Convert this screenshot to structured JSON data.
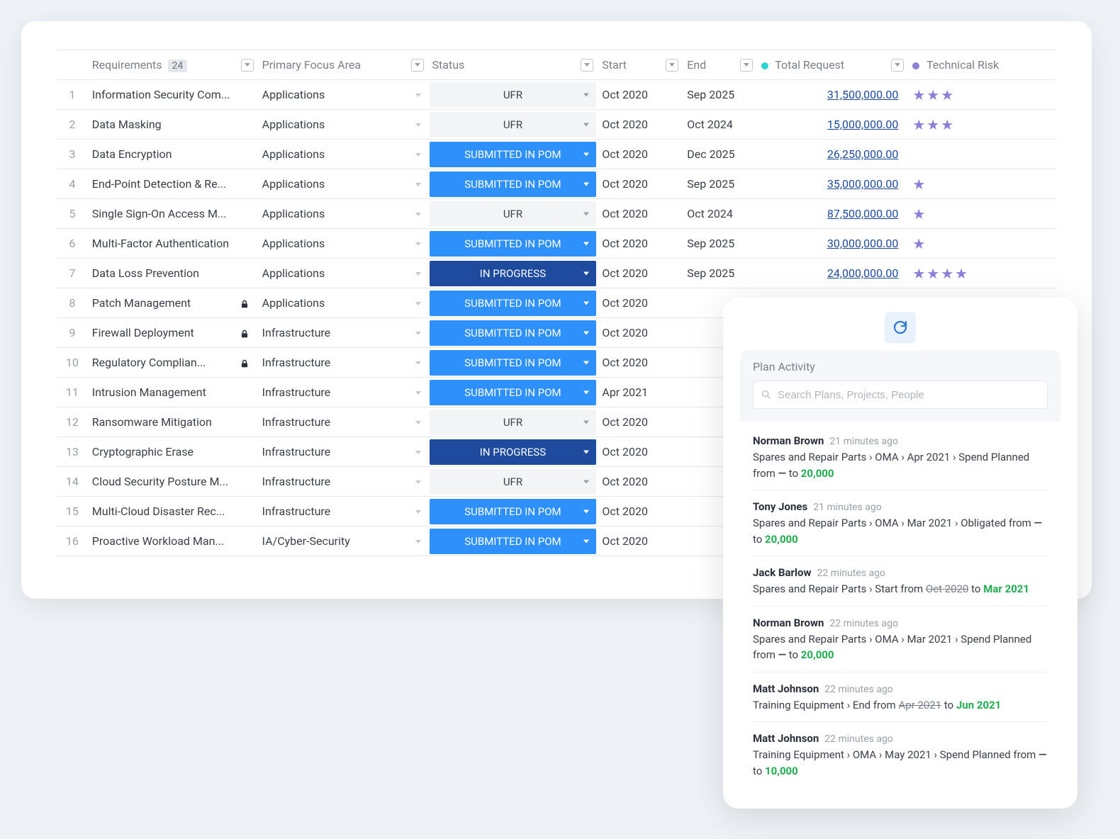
{
  "table": {
    "headers": {
      "requirements": "Requirements",
      "requirements_count": "24",
      "focus": "Primary Focus Area",
      "status": "Status",
      "start": "Start",
      "end": "End",
      "total": "Total Request",
      "risk": "Technical Risk"
    },
    "statuses": {
      "ufr": "UFR",
      "submitted": "SUBMITTED IN POM",
      "inprogress": "IN PROGRESS"
    },
    "rows": [
      {
        "n": "1",
        "req": "Information Security Com...",
        "focus": "Applications",
        "status": "ufr",
        "start": "Oct 2020",
        "end": "Sep 2025",
        "total": "31,500,000.00",
        "stars": 3,
        "locked": false
      },
      {
        "n": "2",
        "req": "Data Masking",
        "focus": "Applications",
        "status": "ufr",
        "start": "Oct 2020",
        "end": "Oct 2024",
        "total": "15,000,000.00",
        "stars": 3,
        "locked": false
      },
      {
        "n": "3",
        "req": "Data Encryption",
        "focus": "Applications",
        "status": "submitted",
        "start": "Oct 2020",
        "end": "Dec 2025",
        "total": "26,250,000.00",
        "stars": 0,
        "locked": false
      },
      {
        "n": "4",
        "req": "End-Point Detection & Re...",
        "focus": "Applications",
        "status": "submitted",
        "start": "Oct 2020",
        "end": "Sep 2025",
        "total": "35,000,000.00",
        "stars": 1,
        "locked": false
      },
      {
        "n": "5",
        "req": "Single Sign-On Access M...",
        "focus": "Applications",
        "status": "ufr",
        "start": "Oct 2020",
        "end": "Oct 2024",
        "total": "87,500,000.00",
        "stars": 1,
        "locked": false
      },
      {
        "n": "6",
        "req": "Multi-Factor Authentication",
        "focus": "Applications",
        "status": "submitted",
        "start": "Oct 2020",
        "end": "Sep 2025",
        "total": "30,000,000.00",
        "stars": 1,
        "locked": false
      },
      {
        "n": "7",
        "req": "Data Loss Prevention",
        "focus": "Applications",
        "status": "inprogress",
        "start": "Oct 2020",
        "end": "Sep 2025",
        "total": "24,000,000.00",
        "stars": 4,
        "locked": false
      },
      {
        "n": "8",
        "req": "Patch Management",
        "focus": "Applications",
        "status": "submitted",
        "start": "Oct 2020",
        "end": "",
        "total": "",
        "stars": 0,
        "locked": true
      },
      {
        "n": "9",
        "req": "Firewall Deployment",
        "focus": "Infrastructure",
        "status": "submitted",
        "start": "Oct 2020",
        "end": "",
        "total": "",
        "stars": 0,
        "locked": true
      },
      {
        "n": "10",
        "req": "Regulatory Complian...",
        "focus": "Infrastructure",
        "status": "submitted",
        "start": "Oct 2020",
        "end": "",
        "total": "",
        "stars": 0,
        "locked": true
      },
      {
        "n": "11",
        "req": "Intrusion Management",
        "focus": "Infrastructure",
        "status": "submitted",
        "start": "Apr 2021",
        "end": "",
        "total": "",
        "stars": 0,
        "locked": false
      },
      {
        "n": "12",
        "req": "Ransomware Mitigation",
        "focus": "Infrastructure",
        "status": "ufr",
        "start": "Oct 2020",
        "end": "",
        "total": "",
        "stars": 0,
        "locked": false
      },
      {
        "n": "13",
        "req": "Cryptographic Erase",
        "focus": "Infrastructure",
        "status": "inprogress",
        "start": "Oct 2020",
        "end": "",
        "total": "",
        "stars": 0,
        "locked": false
      },
      {
        "n": "14",
        "req": "Cloud Security Posture M...",
        "focus": "Infrastructure",
        "status": "ufr",
        "start": "Oct 2020",
        "end": "",
        "total": "",
        "stars": 0,
        "locked": false
      },
      {
        "n": "15",
        "req": "Multi-Cloud Disaster Rec...",
        "focus": "Infrastructure",
        "status": "submitted",
        "start": "Oct 2020",
        "end": "",
        "total": "",
        "stars": 0,
        "locked": false
      },
      {
        "n": "16",
        "req": "Proactive Workload Man...",
        "focus": "IA/Cyber-Security",
        "status": "submitted",
        "start": "Oct 2020",
        "end": "",
        "total": "",
        "stars": 0,
        "locked": false
      }
    ]
  },
  "activity": {
    "title": "Plan Activity",
    "search_placeholder": "Search Plans, Projects, People",
    "items": [
      {
        "user": "Norman Brown",
        "time": "21 minutes ago",
        "prefix": "Spares and Repair Parts › OMA › Apr 2021 › Spend Planned from ",
        "old": "—",
        "mid": " to ",
        "new": "20,000",
        "suffix": ""
      },
      {
        "user": "Tony Jones",
        "time": "21 minutes ago",
        "prefix": "Spares and Repair Parts › OMA › Mar 2021 › Obligated from ",
        "old": "—",
        "mid": " to ",
        "new": "20,000",
        "suffix": ""
      },
      {
        "user": "Jack Barlow",
        "time": "22 minutes ago",
        "prefix": "Spares and Repair Parts › Start from ",
        "old": "Oct 2020",
        "old_strike": true,
        "mid": " to ",
        "new": "Mar 2021",
        "suffix": ""
      },
      {
        "user": "Norman Brown",
        "time": "22 minutes ago",
        "prefix": "Spares and Repair Parts › OMA › Mar 2021 › Spend Planned from ",
        "old": "—",
        "mid": " to ",
        "new": "20,000",
        "suffix": ""
      },
      {
        "user": "Matt Johnson",
        "time": "22 minutes ago",
        "prefix": "Training Equipment › End from ",
        "old": "Apr 2021",
        "old_strike": true,
        "mid": " to ",
        "new": "Jun 2021",
        "suffix": ""
      },
      {
        "user": "Matt Johnson",
        "time": "22 minutes ago",
        "prefix": "Training Equipment › OMA › May 2021 › Spend Planned from ",
        "old": "—",
        "mid": " to ",
        "new": "10,000",
        "suffix": ""
      }
    ]
  }
}
